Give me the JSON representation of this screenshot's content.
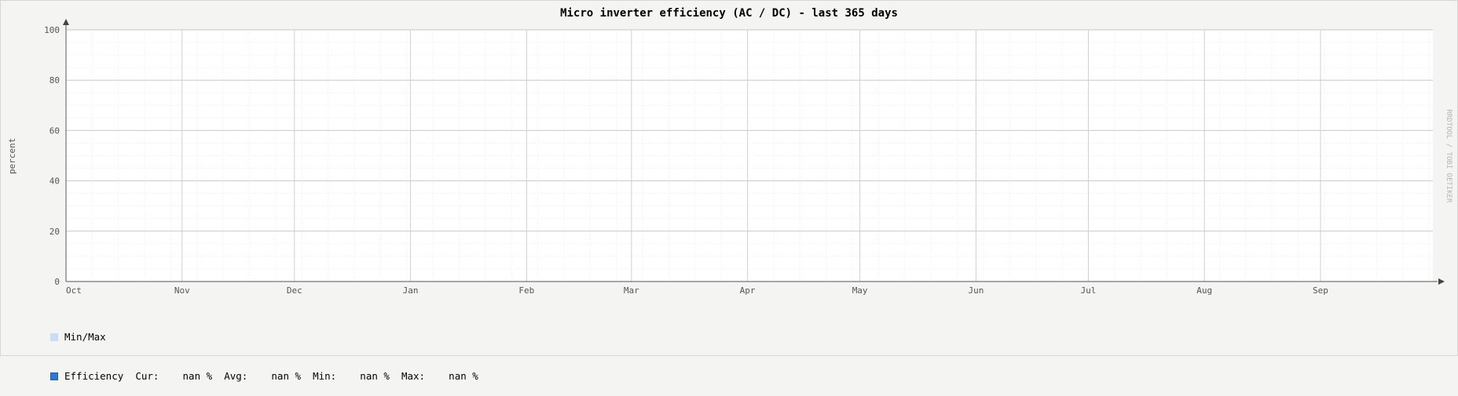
{
  "chart_data": {
    "type": "line",
    "title": "Micro inverter efficiency (AC / DC) - last 365 days",
    "ylabel": "percent",
    "xlabel": "",
    "ylim": [
      0,
      100
    ],
    "y_ticks": [
      0,
      20,
      40,
      60,
      80,
      100
    ],
    "x_ticks": [
      "Oct",
      "Nov",
      "Dec",
      "Jan",
      "Feb",
      "Mar",
      "Apr",
      "May",
      "Jun",
      "Jul",
      "Aug",
      "Sep"
    ],
    "grid": true,
    "series": [
      {
        "name": "Min/Max",
        "color": "#c8dcf5",
        "values": []
      },
      {
        "name": "Efficiency",
        "color": "#2f78d2",
        "values": []
      }
    ],
    "legend_placement": "bottom-left",
    "legend": {
      "minmax_label": "Min/Max",
      "efficiency_label": "Efficiency",
      "stats_text": "  Cur:    nan %  Avg:    nan %  Min:    nan %  Max:    nan %"
    },
    "watermark": "RRDTOOL / TOBI OETIKER"
  }
}
